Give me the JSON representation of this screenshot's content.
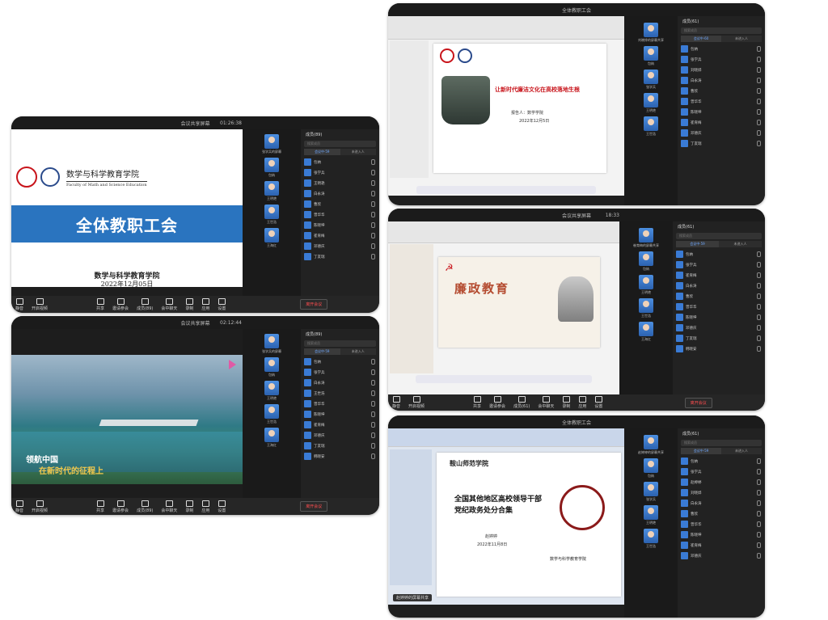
{
  "colors": {
    "end_button": "#ff4d4f",
    "slide_blue": "#2a74bf",
    "slide_red": "#c8141b"
  },
  "window1": {
    "title": "会议共享屏幕",
    "timer": "01:26:38",
    "tab_title": "成员(89)",
    "search_placeholder": "搜索成员",
    "tab_in_meeting": "会议中·59",
    "tab_not_joined": "未进入人",
    "members": [
      "包纳",
      "张学兵",
      "王明艳",
      "白永涛",
      "曹欣",
      "曾华华",
      "陈晓坤",
      "崔育梅",
      "邓德庆",
      "丁友瑞"
    ],
    "video_names": [
      "张学兵的屏幕",
      "包纳",
      "王明艳",
      "王世浩",
      "王海红"
    ],
    "slide": {
      "school": "数学与科学教育学院",
      "school_en": "Faculty of Math and Science Education",
      "banner": "全体教职工会",
      "footer_school": "数学与科学教育学院",
      "date": "2022年12月05日"
    },
    "toolbar": [
      "静音",
      "开启视频",
      "共享",
      "邀请参会",
      "成员(89)",
      "会中聊天",
      "录制",
      "应用",
      "设置"
    ],
    "end_label": "离开会议"
  },
  "window2": {
    "title": "会议共享屏幕",
    "timer": "02:12:44",
    "tab_title": "成员(89)",
    "search_placeholder": "搜索成员",
    "tab_in_meeting": "会议中·59",
    "tab_not_joined": "未进入人",
    "members": [
      "包纳",
      "张学兵",
      "白永涛",
      "王世浩",
      "曾华华",
      "陈晓坤",
      "崔育梅",
      "邓德庆",
      "丁友瑞",
      "韩晓安"
    ],
    "video_names": [
      "张学兵的屏幕",
      "包纳",
      "王明艳",
      "王世浩",
      "王海红"
    ],
    "video_caption_1": "领航中国",
    "video_caption_2": "在新时代的征程上",
    "toolbar": [
      "静音",
      "开启视频",
      "共享",
      "邀请参会",
      "成员(89)",
      "会中聊天",
      "录制",
      "应用",
      "设置"
    ],
    "end_label": "离开会议"
  },
  "window3": {
    "title": "全体教职工会",
    "tab_title": "成员(61)",
    "search_placeholder": "搜索成员",
    "tab_in_meeting": "会议中·60",
    "tab_not_joined": "未进入人",
    "members": [
      "包纳",
      "张学兵",
      "刘晓烨",
      "白永涛",
      "曹欣",
      "曾华华",
      "陈晓坤",
      "崔育梅",
      "邓德庆",
      "丁友瑞"
    ],
    "video_names": [
      "刘晓烨的屏幕共享",
      "包纳",
      "张学兵",
      "王明艳",
      "王世浩"
    ],
    "slide": {
      "headline": "让新时代廉洁文化在高校落地生根",
      "speaker": "报告人：数学学院",
      "date": "2022年12月5日"
    }
  },
  "window4": {
    "title": "会议共享屏幕",
    "timer": "18:33",
    "tab_title": "成员(61)",
    "search_placeholder": "搜索成员",
    "tab_in_meeting": "会议中·59",
    "tab_not_joined": "未进入人",
    "members": [
      "包纳",
      "张学兵",
      "崔育梅",
      "白永涛",
      "曹欣",
      "曾华华",
      "陈晓坤",
      "邓德庆",
      "丁友瑞",
      "韩晓安"
    ],
    "video_names": [
      "崔育梅的屏幕共享",
      "包纳",
      "王明艳",
      "王世浩",
      "王海红"
    ],
    "slide": {
      "headline": "廉政教育"
    },
    "toolbar": [
      "静音",
      "开启视频",
      "共享",
      "邀请参会",
      "成员(61)",
      "会中聊天",
      "录制",
      "应用",
      "设置"
    ],
    "end_label": "离开会议"
  },
  "window5": {
    "title": "全体教职工会",
    "tab_title": "成员(61)",
    "search_placeholder": "搜索成员",
    "tab_in_meeting": "会议中·59",
    "tab_not_joined": "未进入人",
    "members": [
      "包纳",
      "张学兵",
      "赵婷婷",
      "刘晓烨",
      "白永涛",
      "曹欣",
      "曾华华",
      "陈晓坤",
      "崔育梅",
      "邓德庆"
    ],
    "video_names": [
      "赵婷婷的屏幕共享",
      "包纳",
      "张学兵",
      "王明艳",
      "王世浩"
    ],
    "slide": {
      "logo_text": "鞍山师范学院",
      "headline_1": "全国其他地区高校领导干部",
      "headline_2": "党纪政务处分合集",
      "author": "赵婷婷",
      "date": "2022年11月8日",
      "footer": "数学与科学教育学院"
    },
    "status": "赵婷婷的屏幕共享"
  }
}
